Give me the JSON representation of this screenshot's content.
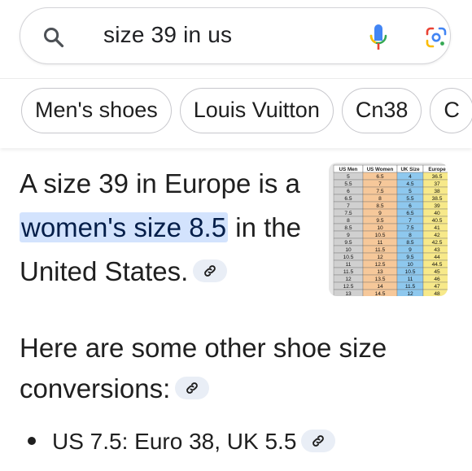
{
  "search": {
    "query": "size 39 in us",
    "icons": {
      "search": "magnifier-icon",
      "voice": "mic-icon",
      "lens": "google-lens-icon"
    }
  },
  "chips": [
    "Men's shoes",
    "Louis Vuitton",
    "Cn38",
    "C"
  ],
  "answer": {
    "prefix": "A size 39 in Europe is a ",
    "highlight": "women's size 8.5",
    "suffix": " in the United States.",
    "highlight_color": "#d3e3fd"
  },
  "size_table": {
    "headers": [
      "US Men",
      "US Women",
      "UK Size",
      "Europe"
    ],
    "rows": [
      [
        "5",
        "6.5",
        "4",
        "36.5"
      ],
      [
        "5.5",
        "7",
        "4.5",
        "37"
      ],
      [
        "6",
        "7.5",
        "5",
        "38"
      ],
      [
        "6.5",
        "8",
        "5.5",
        "38.5"
      ],
      [
        "7",
        "8.5",
        "6",
        "39"
      ],
      [
        "7.5",
        "9",
        "6.5",
        "40"
      ],
      [
        "8",
        "9.5",
        "7",
        "40.5"
      ],
      [
        "8.5",
        "10",
        "7.5",
        "41"
      ],
      [
        "9",
        "10.5",
        "8",
        "42"
      ],
      [
        "9.5",
        "11",
        "8.5",
        "42.5"
      ],
      [
        "10",
        "11.5",
        "9",
        "43"
      ],
      [
        "10.5",
        "12",
        "9.5",
        "44"
      ],
      [
        "11",
        "12.5",
        "10",
        "44.5"
      ],
      [
        "11.5",
        "13",
        "10.5",
        "45"
      ],
      [
        "12",
        "13.5",
        "11",
        "46"
      ],
      [
        "12.5",
        "14",
        "11.5",
        "47"
      ],
      [
        "13",
        "14.5",
        "12",
        "48"
      ]
    ],
    "column_colors": [
      "#d0d0d0",
      "#f6c89a",
      "#8ec8ee",
      "#f7e98a"
    ]
  },
  "more": {
    "heading": "Here are some other shoe size conversions:",
    "bullets": [
      "US 7.5: Euro 38, UK 5.5"
    ]
  }
}
